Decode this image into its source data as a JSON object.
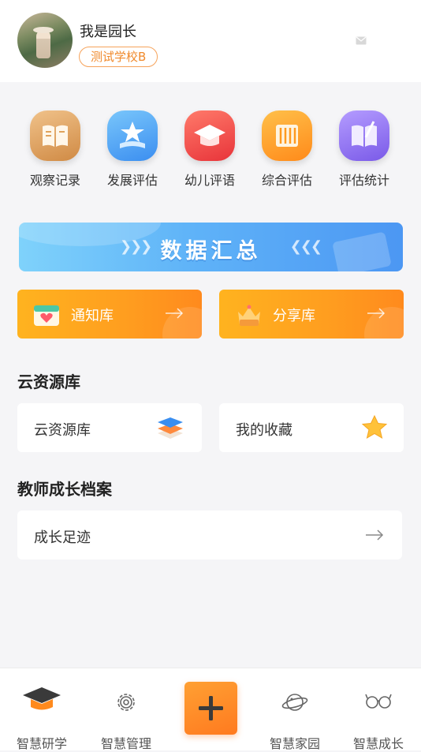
{
  "user": {
    "name": "我是园长",
    "school": "测试学校B"
  },
  "quick_menu": [
    {
      "label": "观察记录",
      "icon": "open-book-icon",
      "color": "#e0a35c"
    },
    {
      "label": "发展评估",
      "icon": "star-podium-icon",
      "color": "#4ea5f2"
    },
    {
      "label": "幼儿评语",
      "icon": "graduation-cap-icon",
      "color": "#f0524b"
    },
    {
      "label": "综合评估",
      "icon": "scroll-icon",
      "color": "#ff9a1f"
    },
    {
      "label": "评估统计",
      "icon": "notebook-pen-icon",
      "color": "#8a6cf0"
    }
  ],
  "banner": {
    "label": "数据汇总"
  },
  "libraries": {
    "notice": "通知库",
    "share": "分享库"
  },
  "cloud": {
    "title": "云资源库",
    "resources": "云资源库",
    "favorites": "我的收藏"
  },
  "teacher": {
    "title": "教师成长档案",
    "footprint": "成长足迹"
  },
  "tabbar": {
    "items": [
      {
        "label": "智慧研学",
        "icon": "mortarboard-icon"
      },
      {
        "label": "智慧管理",
        "icon": "gear-icon"
      },
      {
        "label": "智慧家园",
        "icon": "planet-icon"
      },
      {
        "label": "智慧成长",
        "icon": "glasses-icon"
      }
    ],
    "add_icon": "plus-icon"
  },
  "colors": {
    "accent": "#ff8a1d",
    "badge": "#f08a2c",
    "banner": "#5fb3f8"
  }
}
